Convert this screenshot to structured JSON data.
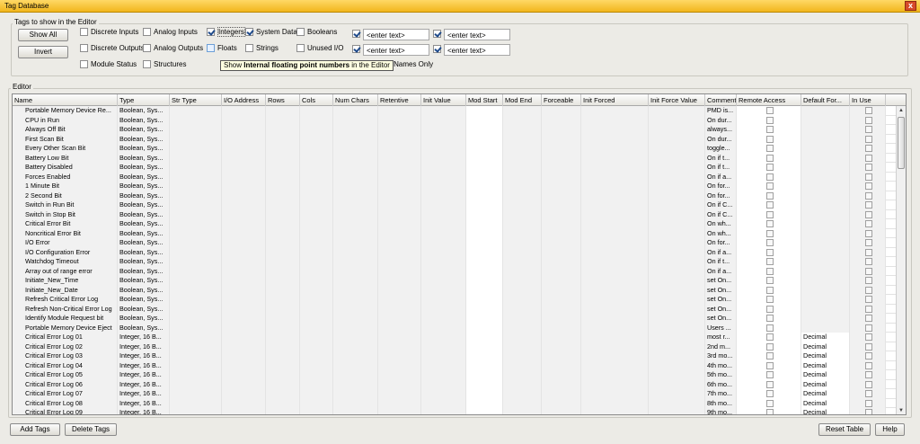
{
  "window": {
    "title": "Tag Database",
    "close_label": "x"
  },
  "filter": {
    "group_label": "Tags to show in the Editor",
    "show_all_label": "Show All",
    "invert_label": "Invert",
    "checkboxes": [
      {
        "label": "Discrete Inputs",
        "checked": false
      },
      {
        "label": "Analog Inputs",
        "checked": false
      },
      {
        "label": "Integers",
        "checked": true
      },
      {
        "label": "System Data",
        "checked": true
      },
      {
        "label": "Booleans",
        "checked": false
      },
      {
        "label": "Discrete Outputs",
        "checked": false
      },
      {
        "label": "Analog Outputs",
        "checked": false
      },
      {
        "label": "Floats",
        "checked": false
      },
      {
        "label": "Strings",
        "checked": false
      },
      {
        "label": "Unused I/O",
        "checked": false
      },
      {
        "label": "Module Status",
        "checked": false
      },
      {
        "label": "Structures",
        "checked": false
      }
    ],
    "text_filters": [
      {
        "checked": true,
        "placeholder": "<enter text>"
      },
      {
        "checked": true,
        "placeholder": "<enter text>"
      },
      {
        "checked": true,
        "placeholder": "<enter text>"
      },
      {
        "checked": true,
        "placeholder": "<enter text>"
      }
    ],
    "tag_names_only_label": "ag Names Only",
    "tooltip": {
      "pre": "Show ",
      "bold": "Internal floating point numbers",
      "post": " in the Editor"
    }
  },
  "editor": {
    "group_label": "Editor",
    "columns": [
      "Name",
      "Type",
      "Str Type",
      "I/O Address",
      "Rows",
      "Cols",
      "Num Chars",
      "Retentive",
      "Init Value",
      "Mod Start",
      "Mod End",
      "Forceable",
      "Init Forced",
      "Init Force Value",
      "Comment",
      "Remote Access",
      "Default For...",
      "In Use"
    ],
    "rows": [
      {
        "name": "Portable Memory Device Re...",
        "type": "Boolean, Sys...",
        "comment": "PMD is...",
        "format": ""
      },
      {
        "name": "CPU in Run",
        "type": "Boolean, Sys...",
        "comment": "On dur...",
        "format": ""
      },
      {
        "name": "Always Off Bit",
        "type": "Boolean, Sys...",
        "comment": "always...",
        "format": ""
      },
      {
        "name": "First Scan Bit",
        "type": "Boolean, Sys...",
        "comment": "On dur...",
        "format": ""
      },
      {
        "name": "Every Other Scan Bit",
        "type": "Boolean, Sys...",
        "comment": "toggle...",
        "format": ""
      },
      {
        "name": "Battery Low Bit",
        "type": "Boolean, Sys...",
        "comment": "On if t...",
        "format": ""
      },
      {
        "name": "Battery Disabled",
        "type": "Boolean, Sys...",
        "comment": "On if t...",
        "format": ""
      },
      {
        "name": "Forces Enabled",
        "type": "Boolean, Sys...",
        "comment": "On if a...",
        "format": ""
      },
      {
        "name": "1 Minute Bit",
        "type": "Boolean, Sys...",
        "comment": "On for...",
        "format": ""
      },
      {
        "name": "2 Second Bit",
        "type": "Boolean, Sys...",
        "comment": "On for...",
        "format": ""
      },
      {
        "name": "Switch in Run Bit",
        "type": "Boolean, Sys...",
        "comment": "On if C...",
        "format": ""
      },
      {
        "name": "Switch in Stop Bit",
        "type": "Boolean, Sys...",
        "comment": "On if C...",
        "format": ""
      },
      {
        "name": "Critical Error Bit",
        "type": "Boolean, Sys...",
        "comment": "On wh...",
        "format": ""
      },
      {
        "name": "Noncritical Error Bit",
        "type": "Boolean, Sys...",
        "comment": "On wh...",
        "format": ""
      },
      {
        "name": "I/O Error",
        "type": "Boolean, Sys...",
        "comment": "On for...",
        "format": ""
      },
      {
        "name": "I/O Configuration Error",
        "type": "Boolean, Sys...",
        "comment": "On if a...",
        "format": ""
      },
      {
        "name": "Watchdog Timeout",
        "type": "Boolean, Sys...",
        "comment": "On if t...",
        "format": ""
      },
      {
        "name": "Array out of range error",
        "type": "Boolean, Sys...",
        "comment": "On if a...",
        "format": ""
      },
      {
        "name": "Initiate_New_Time",
        "type": "Boolean, Sys...",
        "comment": "set On...",
        "format": ""
      },
      {
        "name": "Initiate_New_Date",
        "type": "Boolean, Sys...",
        "comment": "set On...",
        "format": ""
      },
      {
        "name": "Refresh Critical Error Log",
        "type": "Boolean, Sys...",
        "comment": "set On...",
        "format": ""
      },
      {
        "name": "Refresh Non-Critical Error Log",
        "type": "Boolean, Sys...",
        "comment": "set On...",
        "format": ""
      },
      {
        "name": "Identify Module Request bit",
        "type": "Boolean, Sys...",
        "comment": "set On...",
        "format": ""
      },
      {
        "name": "Portable Memory Device Eject",
        "type": "Boolean, Sys...",
        "comment": "Users ...",
        "format": ""
      },
      {
        "name": "Critical Error Log 01",
        "type": "Integer, 16 B...",
        "comment": "most r...",
        "format": "Decimal"
      },
      {
        "name": "Critical Error Log 02",
        "type": "Integer, 16 B...",
        "comment": "2nd m...",
        "format": "Decimal"
      },
      {
        "name": "Critical Error Log 03",
        "type": "Integer, 16 B...",
        "comment": "3rd mo...",
        "format": "Decimal"
      },
      {
        "name": "Critical Error Log 04",
        "type": "Integer, 16 B...",
        "comment": "4th mo...",
        "format": "Decimal"
      },
      {
        "name": "Critical Error Log 05",
        "type": "Integer, 16 B...",
        "comment": "5th mo...",
        "format": "Decimal"
      },
      {
        "name": "Critical Error Log 06",
        "type": "Integer, 16 B...",
        "comment": "6th mo...",
        "format": "Decimal"
      },
      {
        "name": "Critical Error Log 07",
        "type": "Integer, 16 B...",
        "comment": "7th mo...",
        "format": "Decimal"
      },
      {
        "name": "Critical Error Log 08",
        "type": "Integer, 16 B...",
        "comment": "8th mo...",
        "format": "Decimal"
      },
      {
        "name": "Critical Error Log 09",
        "type": "Integer, 16 B...",
        "comment": "9th mo...",
        "format": "Decimal"
      }
    ]
  },
  "footer": {
    "add_tags_label": "Add Tags",
    "delete_tags_label": "Delete Tags",
    "reset_table_label": "Reset Table",
    "help_label": "Help"
  }
}
